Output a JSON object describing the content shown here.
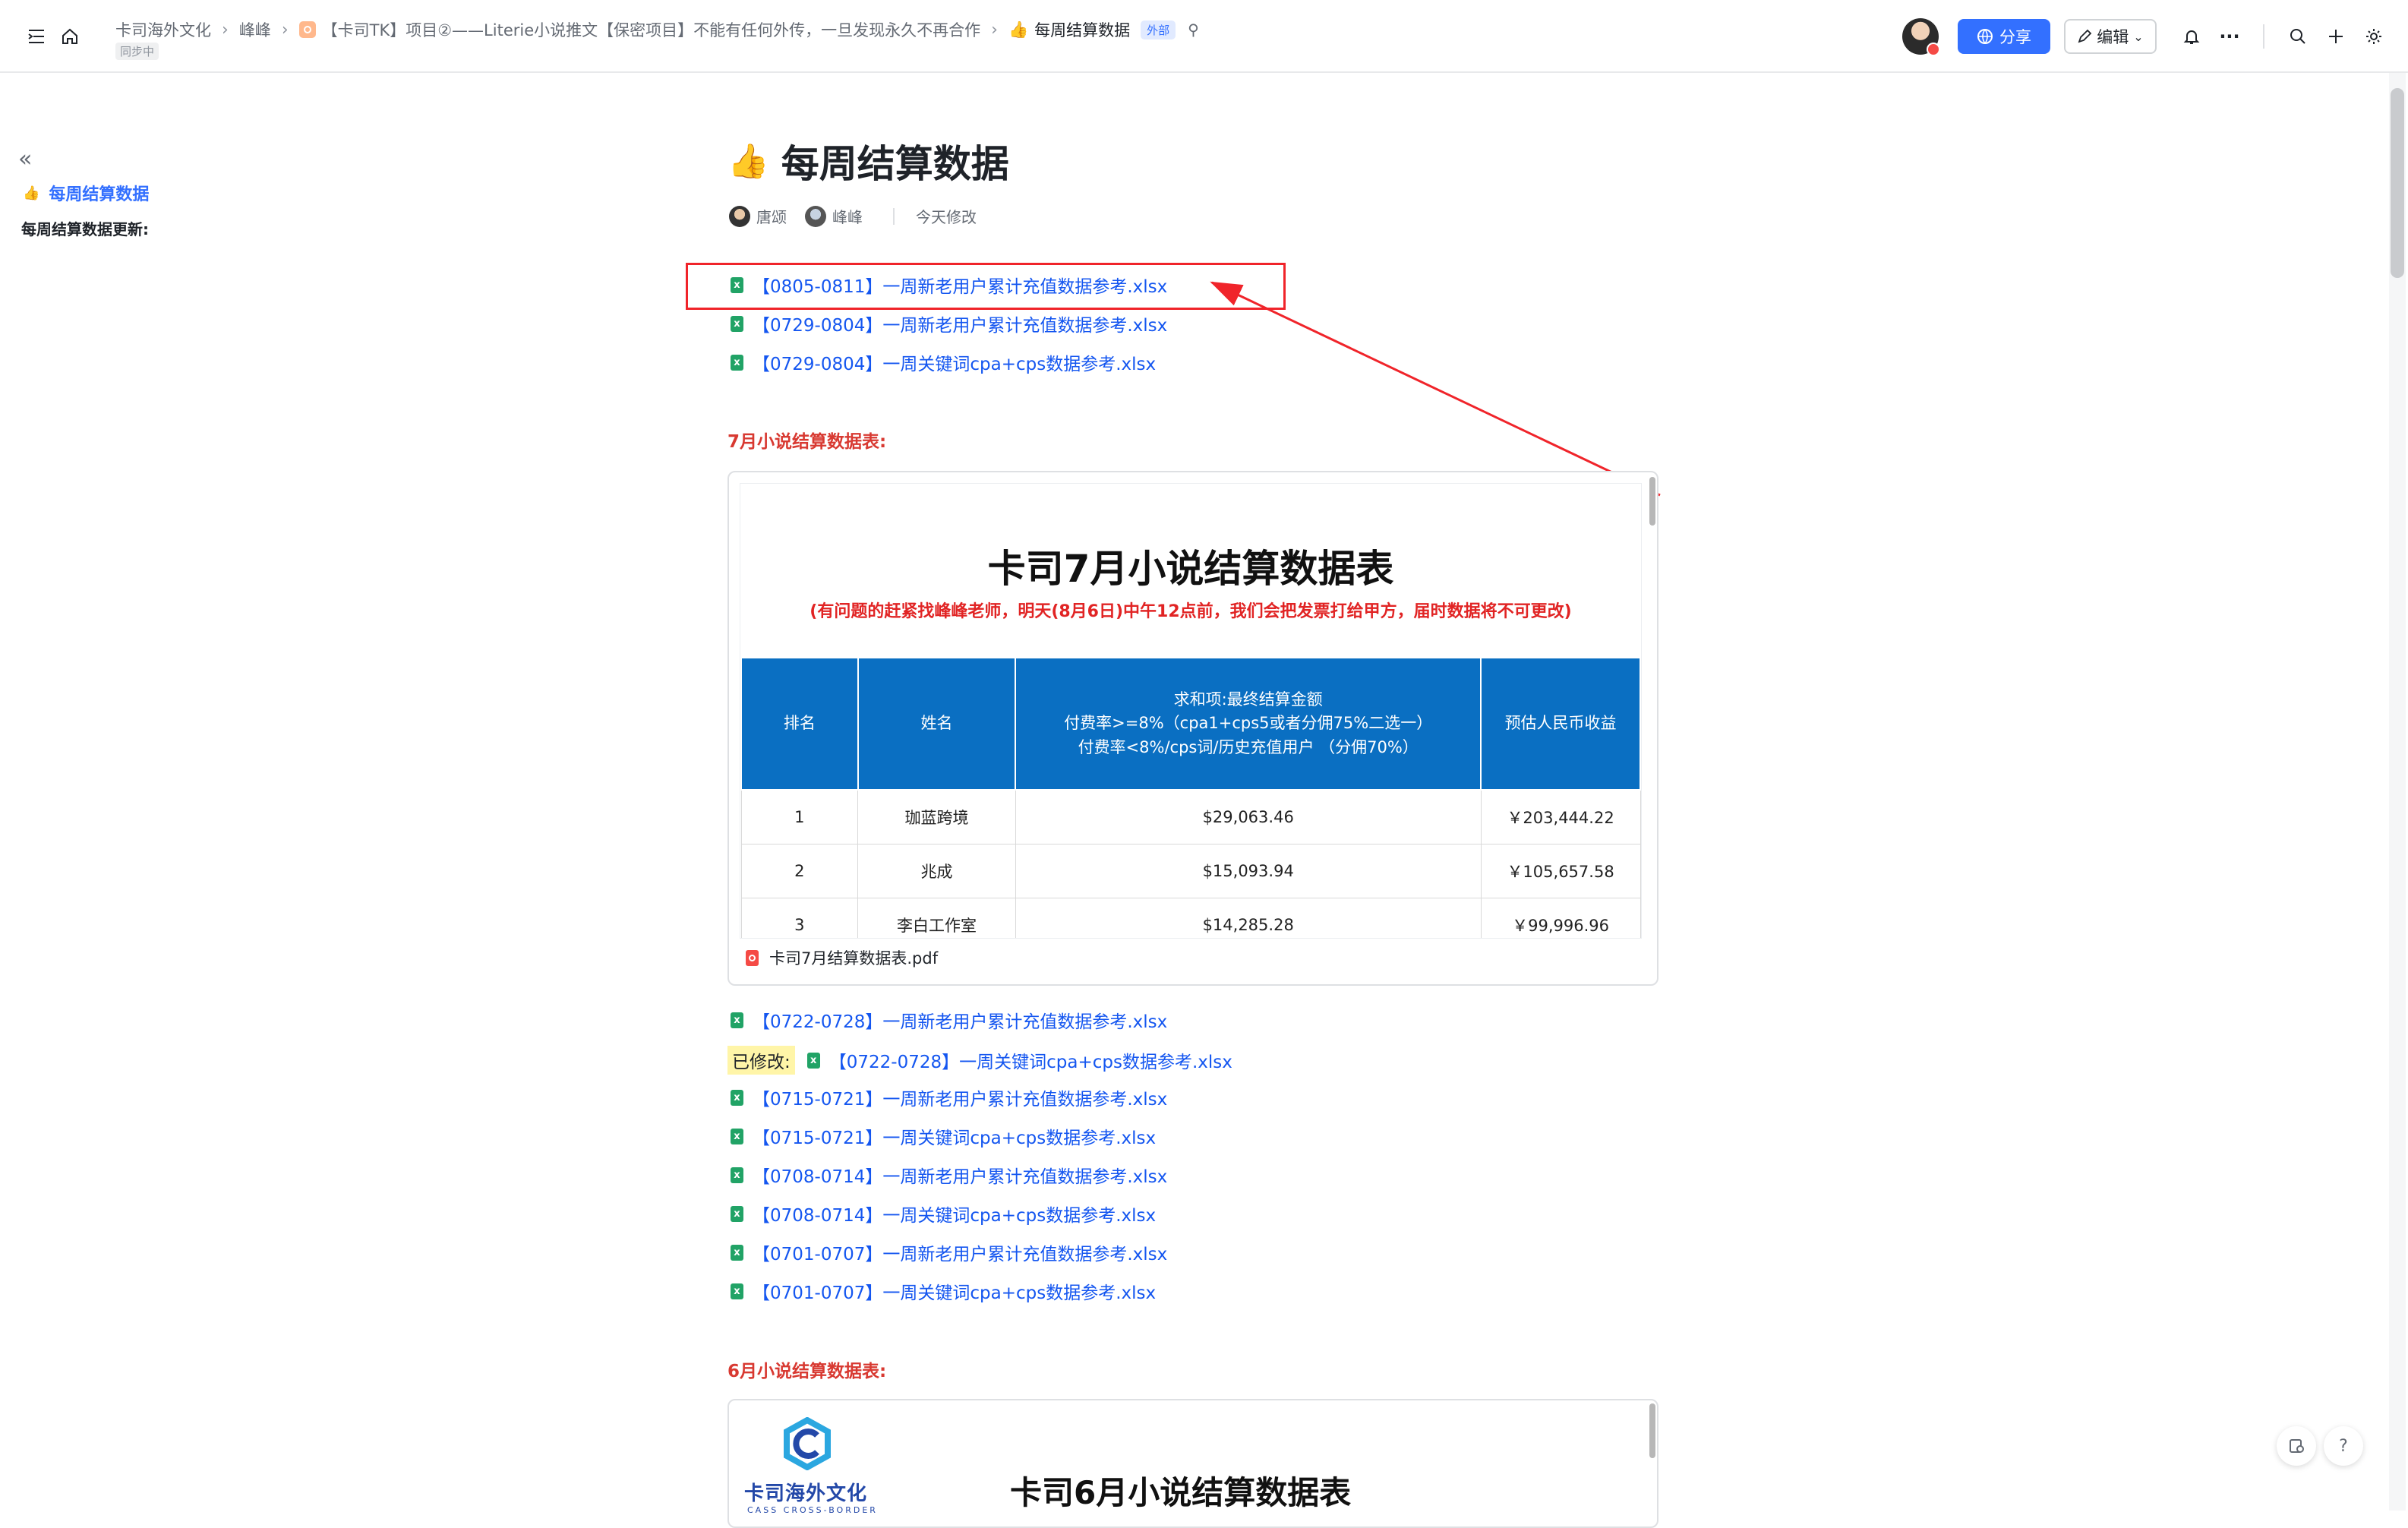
{
  "breadcrumb": {
    "items": [
      "卡司海外文化",
      "峰峰",
      "【卡司TK】项目②——Literie小说推文【保密项目】不能有任何外传，一旦发现永久不再合作",
      "每周结算数据"
    ],
    "external_tag": "外部",
    "sync_status": "同步中"
  },
  "toolbar": {
    "share_label": "分享",
    "edit_label": "编辑"
  },
  "outline": {
    "h1": "每周结算数据",
    "h2": "每周结算数据更新:"
  },
  "doc": {
    "title_emoji": "👍",
    "title": "每周结算数据",
    "authors": [
      "唐颂",
      "峰峰"
    ],
    "modified": "今天修改"
  },
  "files_top": [
    "【0805-0811】一周新老用户累计充值数据参考.xlsx",
    "【0729-0804】一周新老用户累计充值数据参考.xlsx",
    "【0729-0804】一周关键词cpa+cps数据参考.xlsx"
  ],
  "section_july": "7月小说结算数据表:",
  "pdf_july": {
    "title": "卡司7月小说结算数据表",
    "note": "(有问题的赶紧找峰峰老师，明天(8月6日)中午12点前，我们会把发票打给甲方，届时数据将不可更改)",
    "headers": [
      "排名",
      "姓名",
      "求和项:最终结算金额\n付费率>=8%（cpa1+cps5或者分佣75%二选一）\n付费率<8%/cps词/历史充值用户 （分佣70%）",
      "预估人民币收益"
    ],
    "rows": [
      [
        "1",
        "珈蓝跨境",
        "$29,063.46",
        "￥203,444.22"
      ],
      [
        "2",
        "兆成",
        "$15,093.94",
        "￥105,657.58"
      ],
      [
        "3",
        "李白工作室",
        "$14,285.28",
        "￥99,996.96"
      ]
    ],
    "filename": "卡司7月结算数据表.pdf"
  },
  "files_mid": [
    {
      "prefix": "",
      "name": "【0722-0728】一周新老用户累计充值数据参考.xlsx"
    },
    {
      "prefix": "已修改:",
      "name": "【0722-0728】一周关键词cpa+cps数据参考.xlsx"
    },
    {
      "prefix": "",
      "name": "【0715-0721】一周新老用户累计充值数据参考.xlsx"
    },
    {
      "prefix": "",
      "name": "【0715-0721】一周关键词cpa+cps数据参考.xlsx"
    },
    {
      "prefix": "",
      "name": "【0708-0714】一周新老用户累计充值数据参考.xlsx"
    },
    {
      "prefix": "",
      "name": "【0708-0714】一周关键词cpa+cps数据参考.xlsx"
    },
    {
      "prefix": "",
      "name": "【0701-0707】一周新老用户累计充值数据参考.xlsx"
    },
    {
      "prefix": "",
      "name": "【0701-0707】一周关键词cpa+cps数据参考.xlsx"
    }
  ],
  "section_june": "6月小说结算数据表:",
  "pdf_june": {
    "logo_text": "卡司海外文化",
    "logo_sub": "CASS CROSS-BORDER",
    "title": "卡司6月小说结算数据表"
  },
  "colors": {
    "accent": "#3370ff",
    "link": "#1456f0",
    "section_red": "#d83931",
    "table_header": "#0a6fc2",
    "annotation_red": "#f0242a"
  }
}
